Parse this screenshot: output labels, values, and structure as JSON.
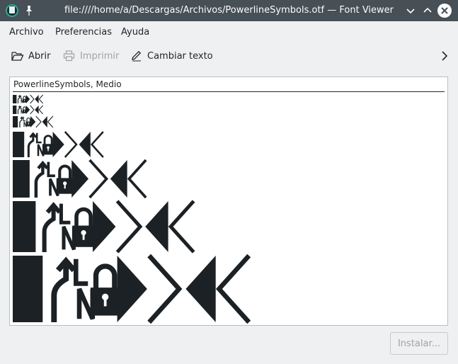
{
  "window": {
    "title": "file:////home/a/Descargas/Archivos/PowerlineSymbols.otf — Font Viewer",
    "app_icon": "font-viewer-app-icon",
    "pin_icon": "pin-icon",
    "controls": [
      "minimize-icon",
      "maximize-icon",
      "close-icon"
    ]
  },
  "menu": {
    "items": [
      "Archivo",
      "Preferencias",
      "Ayuda"
    ]
  },
  "toolbar": {
    "open_label": "Abrir",
    "print_label": "Imprimir",
    "change_text_label": "Cambiar texto",
    "print_enabled": false,
    "more_icon": "chevron-right-icon"
  },
  "preview": {
    "font_label": "PowerlineSymbols, Medio",
    "glyph_names": [
      "full-block",
      "branch",
      "line-number",
      "padlock",
      "right-arrow-solid",
      "right-arrow-line",
      "left-arrow-solid",
      "left-arrow-line"
    ],
    "sample_line_count": 7
  },
  "footer": {
    "install_label": "Instalar...",
    "install_enabled": false
  },
  "colors": {
    "titlebar": "#475057",
    "window_bg": "#eff0f1",
    "glyph": "#1b2124",
    "disabled_text": "#a0a3a6"
  }
}
